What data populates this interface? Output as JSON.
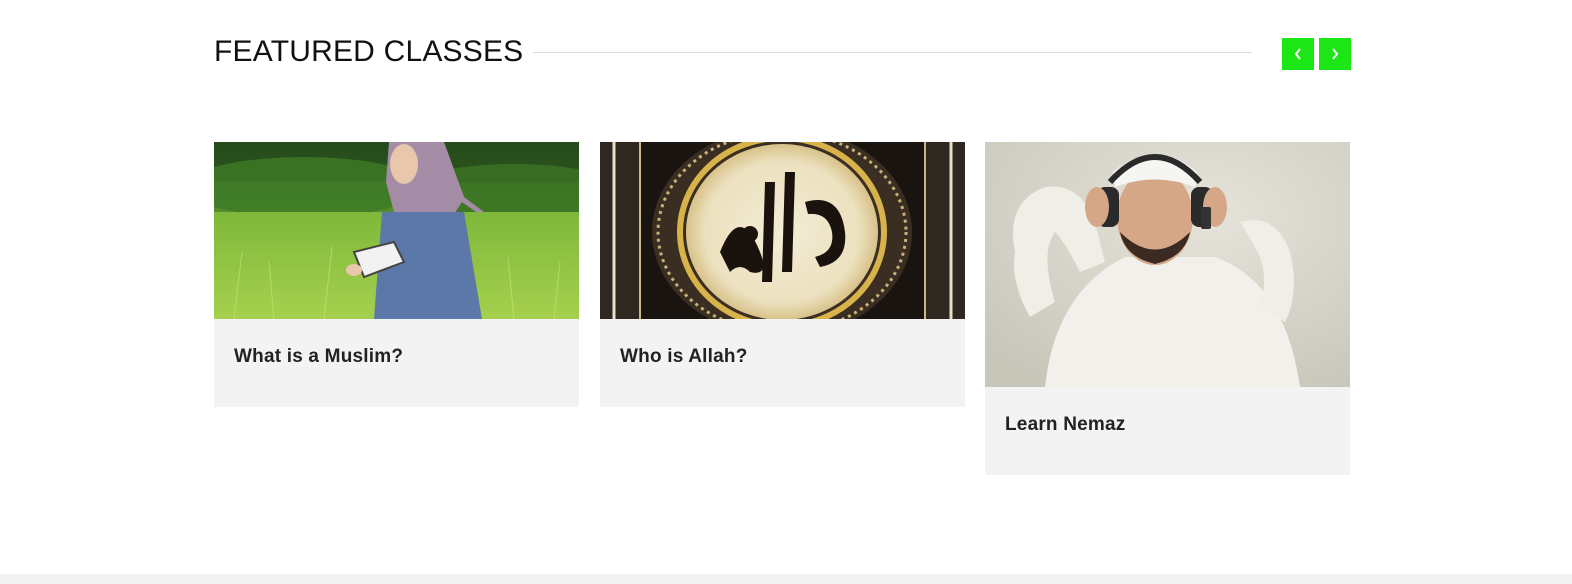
{
  "section": {
    "title": "FEATURED CLASSES",
    "accent_color": "#1ce615",
    "nav": {
      "prev_icon": "chevron-left-icon",
      "next_icon": "chevron-right-icon"
    }
  },
  "cards": [
    {
      "title": "What is a Muslim?",
      "image": "woman-in-hijab-reading-in-meadow"
    },
    {
      "title": "Who is Allah?",
      "image": "arabic-calligraphy-medallion"
    },
    {
      "title": "Learn Nemaz",
      "image": "man-with-headphones-in-white-thobe"
    }
  ]
}
